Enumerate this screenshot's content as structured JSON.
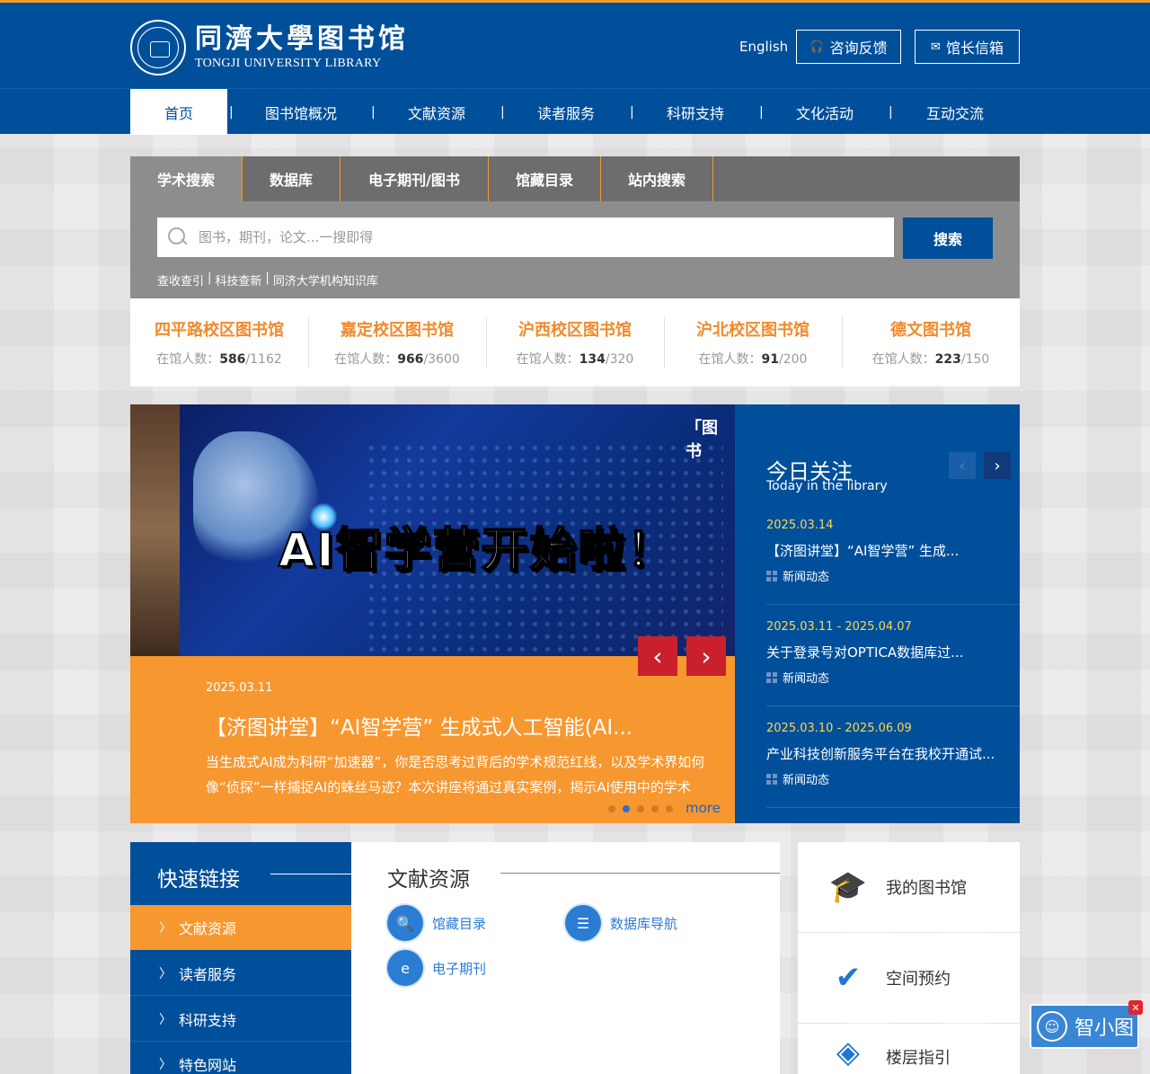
{
  "header": {
    "logo_cn": "同濟大學图书馆",
    "logo_en": "TONGJI UNIVERSITY LIBRARY",
    "lang_link": "English",
    "consult_btn": "咨询反馈",
    "mailbox_btn": "馆长信箱"
  },
  "nav": {
    "items": [
      "首页",
      "图书馆概况",
      "文献资源",
      "读者服务",
      "科研支持",
      "文化活动",
      "互动交流"
    ],
    "separator": "|"
  },
  "search": {
    "tabs": [
      "学术搜索",
      "数据库",
      "电子期刊/图书",
      "馆藏目录",
      "站内搜索"
    ],
    "placeholder": "图书，期刊，论文...一搜即得",
    "button": "搜索",
    "links": [
      "查收查引",
      "科技查新",
      "同济大学机构知识库"
    ],
    "link_sep": "|"
  },
  "branches": {
    "label": "在馆人数：",
    "items": [
      {
        "name": "四平路校区图书馆",
        "current": "586",
        "capacity": "/1162"
      },
      {
        "name": "嘉定校区图书馆",
        "current": "966",
        "capacity": "/3600"
      },
      {
        "name": "沪西校区图书馆",
        "current": "134",
        "capacity": "/320"
      },
      {
        "name": "沪北校区图书馆",
        "current": "91",
        "capacity": "/200"
      },
      {
        "name": "德文图书馆",
        "current": "223",
        "capacity": "/150"
      }
    ]
  },
  "slider": {
    "headline": "AI智学营开始啦！",
    "badge": "「图 书",
    "date": "2025.03.11",
    "title": "【济图讲堂】“AI智学营” 生成式人工智能(AI...",
    "desc_line1": "当生成式AI成为科研“加速器”，你是否思考过背后的学术规范红线，以及学术界如何",
    "desc_line2": "像“侦探”一样捕捉AI的蛛丝马迹？本次讲座将通过真实案例，揭示AI使用中的学术",
    "more": "more",
    "prev": "‹",
    "next": "›",
    "dots_total": 5,
    "active_dot": 2
  },
  "focus": {
    "title": "今日关注",
    "subtitle": "Today in the library",
    "prev": "‹",
    "next": "›",
    "items": [
      {
        "date": "2025.03.14",
        "text": "【济图讲堂】“AI智学营” 生成...",
        "category": "新闻动态"
      },
      {
        "date": "2025.03.11 - 2025.04.07",
        "text": "关于登录号对OPTICA数据库过...",
        "category": "新闻动态"
      },
      {
        "date": "2025.03.10 - 2025.06.09",
        "text": "产业科技创新服务平台在我校开通试...",
        "category": "新闻动态"
      }
    ]
  },
  "quick_links": {
    "title": "快速链接",
    "items": [
      "文献资源",
      "读者服务",
      "科研支持",
      "特色网站"
    ],
    "active_index": 0
  },
  "resources": {
    "title": "文献资源",
    "links": [
      "馆藏目录",
      "数据库导航",
      "电子期刊"
    ]
  },
  "cards": {
    "items": [
      "我的图书馆",
      "空间预约",
      "楼层指引"
    ]
  },
  "assistant": {
    "label": "智小图",
    "close": "✕"
  },
  "colors": {
    "primary": "#004f9a",
    "accent": "#f7972f",
    "top_line": "#f39c2c",
    "branch_name": "#f08a2c",
    "focus_date": "#ffd74a",
    "slider_arrow": "#c9202b"
  }
}
